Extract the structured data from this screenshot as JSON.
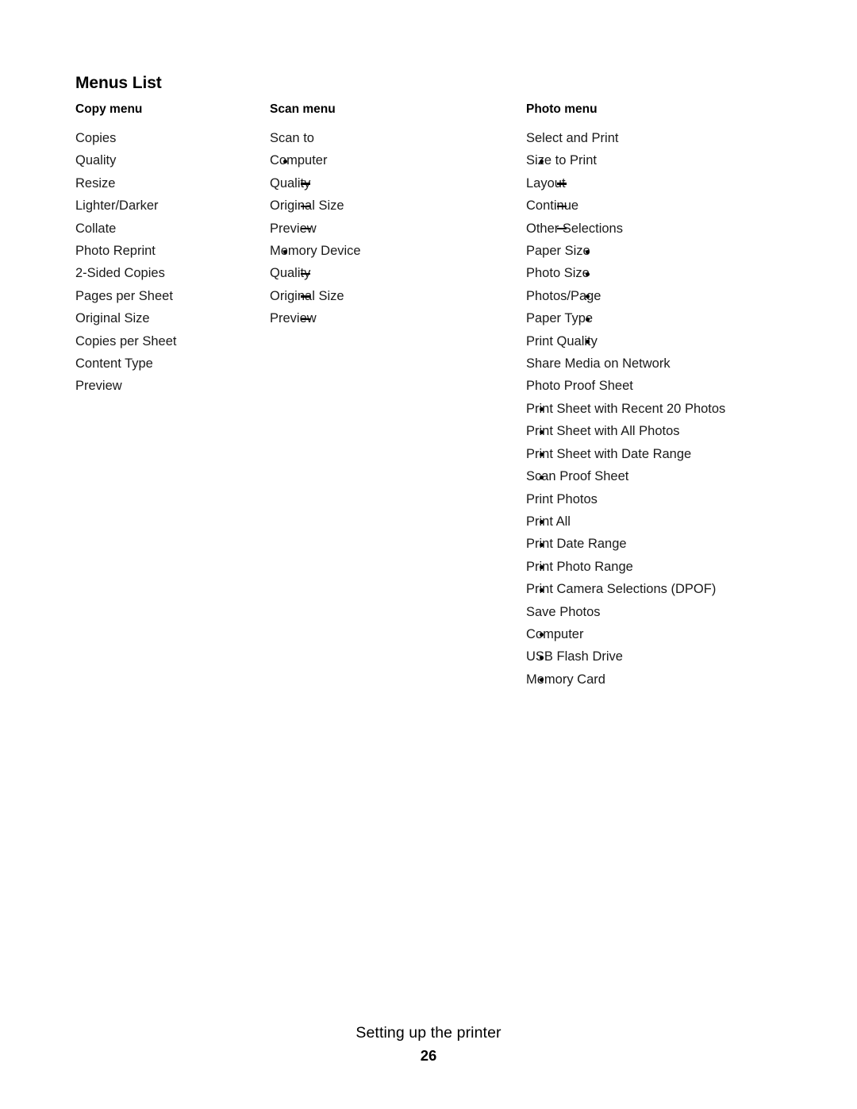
{
  "document": {
    "heading": "Menus List"
  },
  "columns": [
    {
      "id": "copy",
      "title": "Copy menu",
      "items": [
        {
          "level": 0,
          "label": "Copies"
        },
        {
          "level": 0,
          "label": "Quality"
        },
        {
          "level": 0,
          "label": "Resize"
        },
        {
          "level": 0,
          "label": "Lighter/Darker"
        },
        {
          "level": 0,
          "label": "Collate"
        },
        {
          "level": 0,
          "label": "Photo Reprint"
        },
        {
          "level": 0,
          "label": "2-Sided Copies"
        },
        {
          "level": 0,
          "label": "Pages per Sheet"
        },
        {
          "level": 0,
          "label": "Original Size"
        },
        {
          "level": 0,
          "label": "Copies per Sheet"
        },
        {
          "level": 0,
          "label": "Content Type"
        },
        {
          "level": 0,
          "label": "Preview"
        }
      ]
    },
    {
      "id": "scan",
      "title": "Scan menu",
      "items": [
        {
          "level": 0,
          "label": "Scan to"
        },
        {
          "level": 1,
          "label": "Computer"
        },
        {
          "level": 2,
          "label": "Quality"
        },
        {
          "level": 2,
          "label": "Original Size"
        },
        {
          "level": 2,
          "label": "Preview"
        },
        {
          "level": 1,
          "label": "Memory Device"
        },
        {
          "level": 2,
          "label": "Quality"
        },
        {
          "level": 2,
          "label": "Original Size"
        },
        {
          "level": 2,
          "label": "Preview"
        }
      ]
    },
    {
      "id": "photo",
      "title": "Photo menu",
      "items": [
        {
          "level": 0,
          "label": "Select and Print"
        },
        {
          "level": 1,
          "label": "Size to Print"
        },
        {
          "level": 2,
          "label": "Layout"
        },
        {
          "level": 2,
          "label": "Continue"
        },
        {
          "level": 2,
          "label": "Other Selections"
        },
        {
          "level": 3,
          "label": "Paper Size"
        },
        {
          "level": 3,
          "label": "Photo Size"
        },
        {
          "level": 3,
          "label": "Photos/Page"
        },
        {
          "level": 3,
          "label": "Paper Type"
        },
        {
          "level": 3,
          "label": "Print Quality"
        },
        {
          "level": 0,
          "label": "Share Media on Network"
        },
        {
          "level": 0,
          "label": "Photo Proof Sheet"
        },
        {
          "level": 1,
          "label": "Print Sheet with Recent 20 Photos"
        },
        {
          "level": 1,
          "label": "Print Sheet with All Photos"
        },
        {
          "level": 1,
          "label": "Print Sheet with Date Range"
        },
        {
          "level": 1,
          "label": "Scan Proof Sheet"
        },
        {
          "level": 0,
          "label": "Print Photos"
        },
        {
          "level": 1,
          "label": "Print All"
        },
        {
          "level": 1,
          "label": "Print Date Range"
        },
        {
          "level": 1,
          "label": "Print Photo Range"
        },
        {
          "level": 1,
          "label": "Print Camera Selections (DPOF)"
        },
        {
          "level": 0,
          "label": "Save Photos"
        },
        {
          "level": 1,
          "label": "Computer"
        },
        {
          "level": 1,
          "label": "USB Flash Drive"
        },
        {
          "level": 1,
          "label": "Memory Card"
        }
      ]
    }
  ],
  "footer": {
    "section_title": "Setting up the printer",
    "page_number": "26"
  }
}
